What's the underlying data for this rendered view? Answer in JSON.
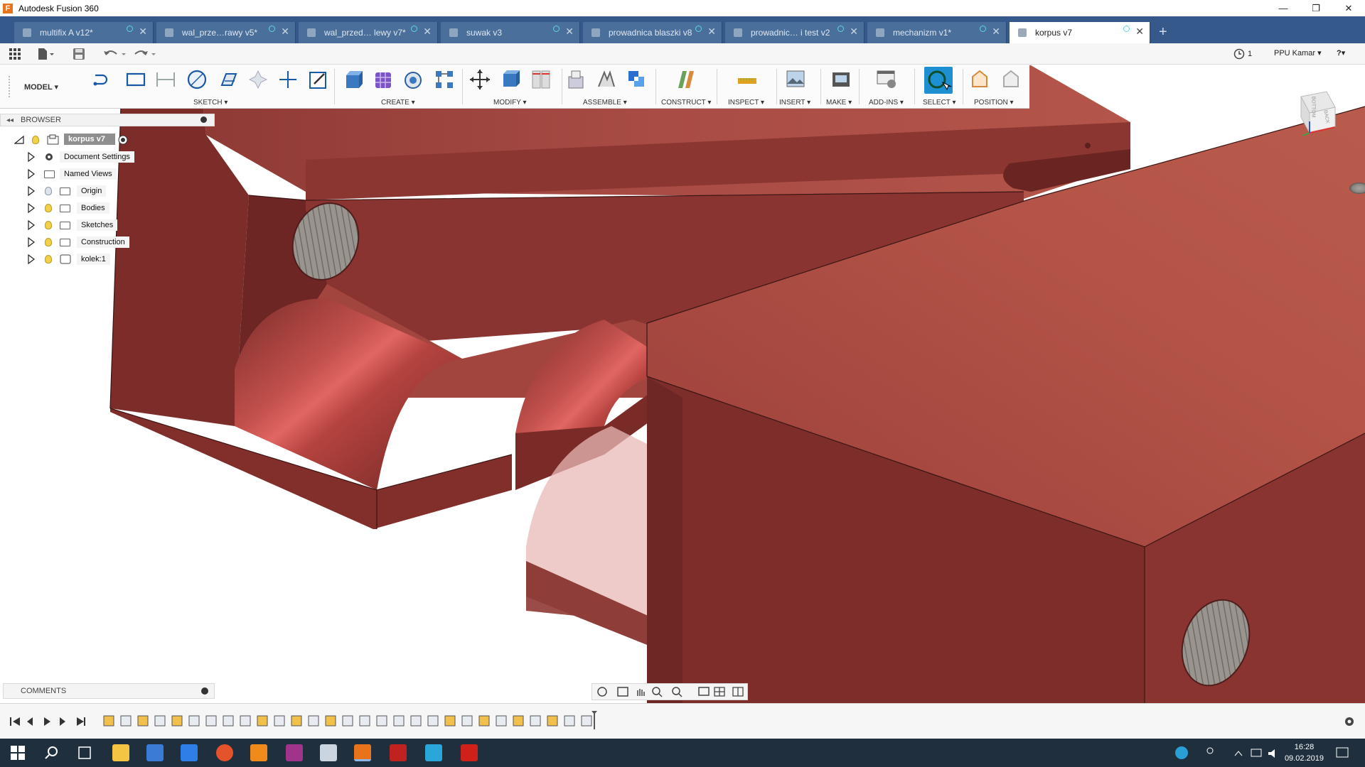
{
  "window": {
    "title": "Autodesk Fusion 360",
    "logo_letter": "F"
  },
  "window_controls": {
    "minimize": "—",
    "restore": "❐",
    "close": "✕"
  },
  "tabs": [
    {
      "label": "multifix A v12*"
    },
    {
      "label": "wal_prze…rawy v5*"
    },
    {
      "label": "wal_przed… lewy v7*"
    },
    {
      "label": "suwak v3"
    },
    {
      "label": "prowadnica blaszki v8"
    },
    {
      "label": "prowadnic… i test v2"
    },
    {
      "label": "mechanizm v1*"
    },
    {
      "label": "korpus v7",
      "active": true
    }
  ],
  "tab_add": "+",
  "tab_close": "✕",
  "quick_access": {
    "jobs_count": "1",
    "user": "PPU Kamar ▾",
    "help": "?▾"
  },
  "workspace": {
    "label": "MODEL ▾"
  },
  "toolbar_groups": [
    {
      "label": "SKETCH ▾"
    },
    {
      "label": "CREATE ▾"
    },
    {
      "label": "MODIFY ▾"
    },
    {
      "label": "ASSEMBLE ▾"
    },
    {
      "label": "CONSTRUCT ▾"
    },
    {
      "label": "INSPECT ▾"
    },
    {
      "label": "INSERT ▾"
    },
    {
      "label": "MAKE ▾"
    },
    {
      "label": "ADD-INS ▾"
    },
    {
      "label": "SELECT ▾"
    },
    {
      "label": "POSITION ▾"
    }
  ],
  "browser": {
    "title": "BROWSER",
    "root": "korpus v7",
    "items": [
      {
        "label": "Document Settings"
      },
      {
        "label": "Named Views"
      },
      {
        "label": "Origin"
      },
      {
        "label": "Bodies"
      },
      {
        "label": "Sketches"
      },
      {
        "label": "Construction"
      },
      {
        "label": "kolek:1"
      }
    ]
  },
  "comments": {
    "title": "COMMENTS"
  },
  "viewcube": {
    "face_bottom": "BOTTOM",
    "face_back": "BACK"
  },
  "taskbar": {
    "time": "16:28",
    "date": "09.02.2019"
  },
  "colors": {
    "tab_bar": "#34598a",
    "body_red": "#8b3330",
    "accent": "#0696d7"
  }
}
